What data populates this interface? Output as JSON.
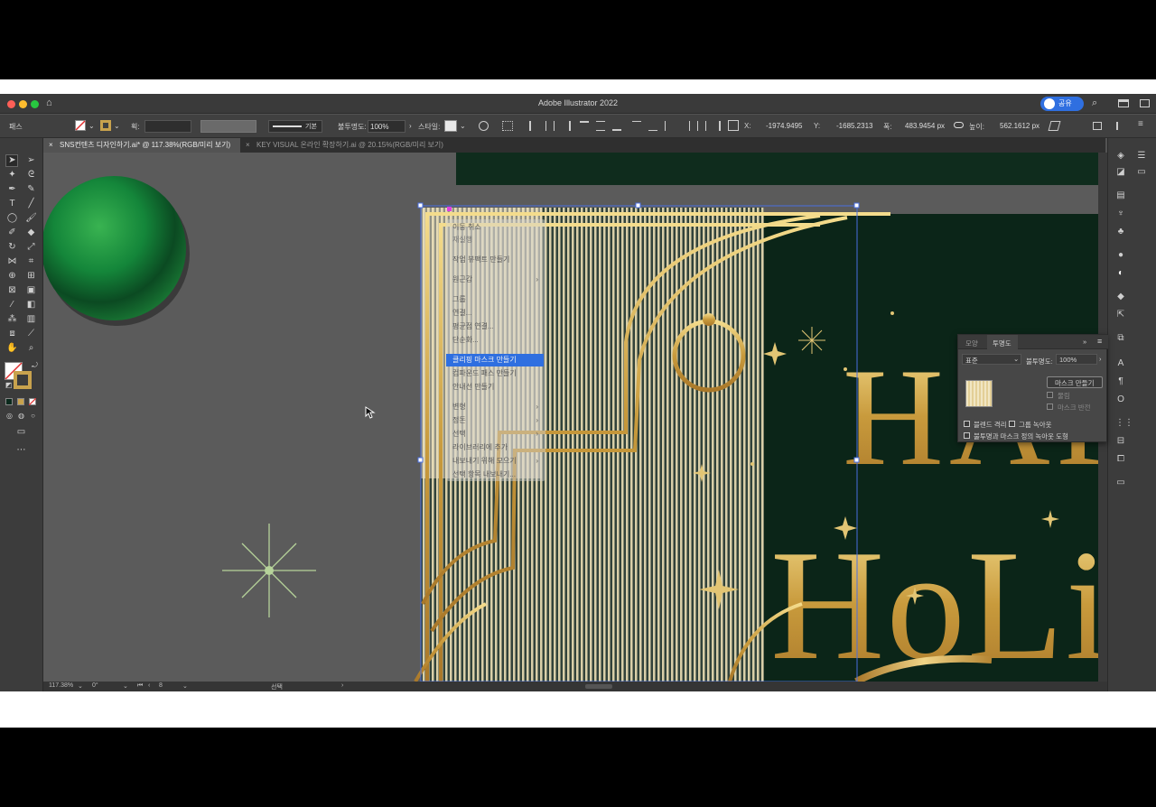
{
  "window": {
    "title": "Adobe Illustrator 2022",
    "share_label": "공유"
  },
  "control_bar": {
    "selection_type": "패스",
    "stroke_label": "획:",
    "stroke_style": "기본",
    "opacity_label": "불투명도:",
    "opacity_value": "100%",
    "style_label": "스타일:",
    "x_label": "X:",
    "x_value": "-1974.9495",
    "y_label": "Y:",
    "y_value": "-1685.2313",
    "w_label": "폭:",
    "w_value": "483.9454 px",
    "h_label": "높이:",
    "h_value": "562.1612 px"
  },
  "tabs": [
    {
      "label": "SNS컨텐츠 디자인하기.ai* @ 117.38%(RGB/미리 보기)",
      "active": true
    },
    {
      "label": "KEY VISUAL 온라인 확장하기.ai @ 20.15%(RGB/미리 보기)",
      "active": false
    }
  ],
  "context_menu": {
    "items": [
      {
        "label": "이동 취소",
        "submenu": false
      },
      {
        "label": "재실행",
        "submenu": false
      },
      {
        "label": "작업 뷰팩트 만들기",
        "submenu": false
      },
      {
        "label": "원근감",
        "submenu": true
      },
      {
        "label": "그룹",
        "submenu": false
      },
      {
        "label": "연결...",
        "submenu": false
      },
      {
        "label": "평균점 연결...",
        "submenu": false
      },
      {
        "label": "단순화...",
        "submenu": false
      },
      {
        "label": "클리핑 마스크 만들기",
        "submenu": false,
        "highlighted": true
      },
      {
        "label": "컴파운드 패스 만들기",
        "submenu": false
      },
      {
        "label": "안내선 만들기",
        "submenu": false
      },
      {
        "label": "변형",
        "submenu": true
      },
      {
        "label": "정돈",
        "submenu": true
      },
      {
        "label": "선택",
        "submenu": true
      },
      {
        "label": "라이브러리에 추가",
        "submenu": false
      },
      {
        "label": "내보내기 위해 모으기",
        "submenu": true
      },
      {
        "label": "선택 항목 내보내기...",
        "submenu": false
      }
    ]
  },
  "transparency_panel": {
    "tabs": [
      "모양",
      "투명도"
    ],
    "blend_mode": "표준",
    "opacity_label": "불투명도:",
    "opacity_value": "100%",
    "make_mask_button": "마스크 만들기",
    "clip_label": "물림",
    "invert_mask_label": "마스크 반전",
    "isolate_blending": "블렌드 격리",
    "knockout_group": "그룹 녹아웃",
    "opacity_mask_knockout": "불투명과 마스크 정의 녹아웃 도형"
  },
  "artwork": {
    "headline_line1": "HAP",
    "headline_line2": "HoLiC"
  },
  "status_bar": {
    "zoom": "117.38%",
    "rotation": "0°",
    "artboard": "8",
    "mode": "선택"
  },
  "colors": {
    "accent": "#2f6fe0",
    "gold": "#c8a24d",
    "dark_green": "#0d2a1c",
    "ornament_green": "#1f8a3a"
  }
}
